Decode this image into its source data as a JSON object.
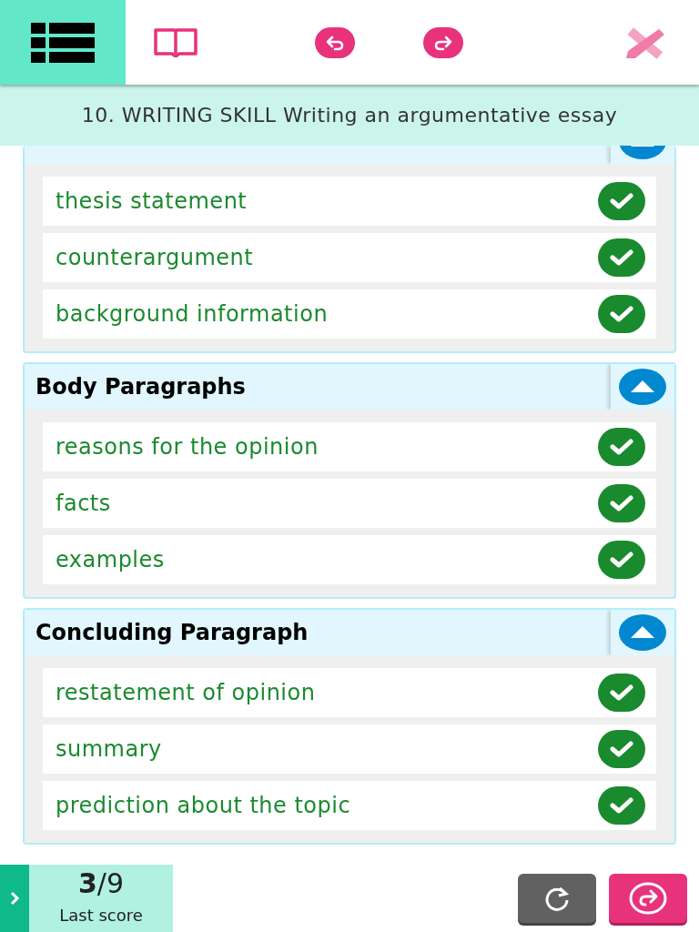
{
  "header": {
    "title": "10. WRITING SKILL Writing an argumentative essay"
  },
  "sections": [
    {
      "expanded": true,
      "items": [
        {
          "text": "thesis statement",
          "correct": true
        },
        {
          "text": "counterargument",
          "correct": true
        },
        {
          "text": "background information",
          "correct": true
        }
      ]
    },
    {
      "title": "Body Paragraphs",
      "expanded": true,
      "items": [
        {
          "text": "reasons for the opinion",
          "correct": true
        },
        {
          "text": "facts",
          "correct": true
        },
        {
          "text": "examples",
          "correct": true
        }
      ]
    },
    {
      "title": "Concluding Paragraph",
      "expanded": true,
      "items": [
        {
          "text": "restatement of opinion",
          "correct": true
        },
        {
          "text": "summary",
          "correct": true
        },
        {
          "text": "prediction about the topic",
          "correct": true
        }
      ]
    }
  ],
  "score": {
    "value": "3",
    "total": "/9",
    "label": "Last score"
  }
}
